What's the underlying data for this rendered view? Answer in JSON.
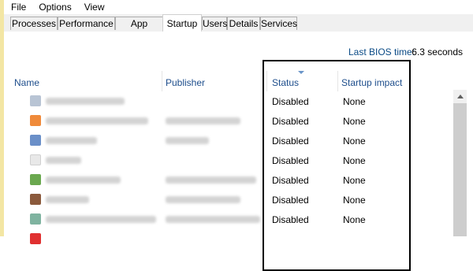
{
  "menu": [
    "File",
    "Options",
    "View"
  ],
  "tabs": [
    "Processes",
    "Performance",
    "App history",
    "Startup",
    "Users",
    "Details",
    "Services"
  ],
  "active_tab": "Startup",
  "bios": {
    "label": "Last BIOS time:",
    "value": "6.3 seconds"
  },
  "columns": {
    "name": "Name",
    "publisher": "Publisher",
    "status": "Status",
    "impact": "Startup impact"
  },
  "rows": [
    {
      "status": "Disabled",
      "impact": "None",
      "icon_color": "#b8c4d4"
    },
    {
      "status": "Disabled",
      "impact": "None",
      "icon_color": "#ef8a3a"
    },
    {
      "status": "Disabled",
      "impact": "None",
      "icon_color": "#6a8fc8"
    },
    {
      "status": "Disabled",
      "impact": "None",
      "icon_color": "#e8e8e8"
    },
    {
      "status": "Disabled",
      "impact": "None",
      "icon_color": "#6aa84f"
    },
    {
      "status": "Disabled",
      "impact": "None",
      "icon_color": "#8b5a3c"
    },
    {
      "status": "Disabled",
      "impact": "None",
      "icon_color": "#7fb3a0"
    },
    {
      "status": "",
      "impact": "",
      "icon_color": "#e03030"
    }
  ],
  "colors": {
    "window_frame": "#f3e6a4",
    "header_text": "#1e4e8c",
    "highlight_border": "#000000"
  }
}
